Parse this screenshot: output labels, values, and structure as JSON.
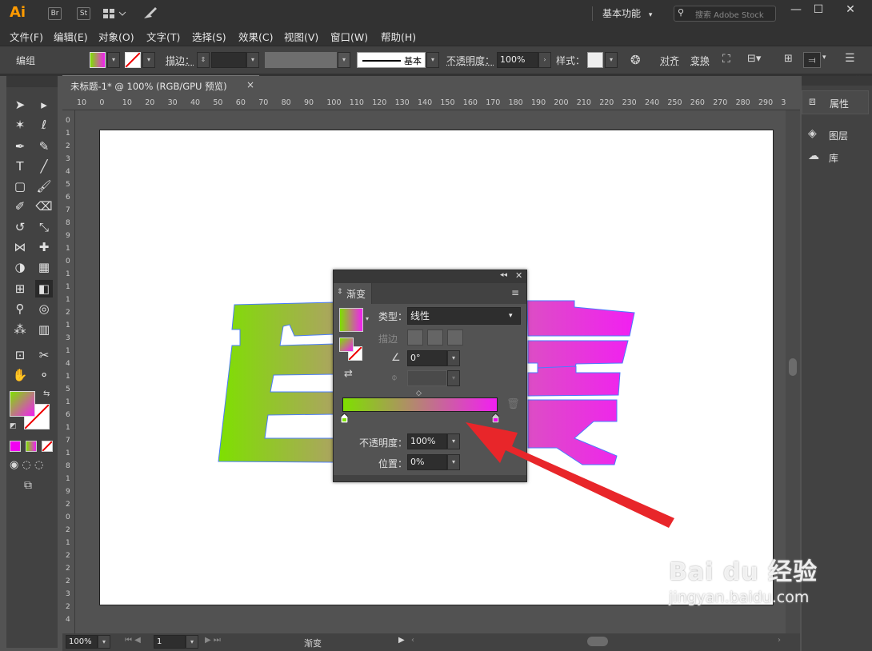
{
  "app": {
    "logo": "Ai",
    "br": "Br",
    "st": "St",
    "workspace": "基本功能",
    "search_placeholder": "搜索 Adobe Stock"
  },
  "menu": [
    "文件(F)",
    "编辑(E)",
    "对象(O)",
    "文字(T)",
    "选择(S)",
    "效果(C)",
    "视图(V)",
    "窗口(W)",
    "帮助(H)"
  ],
  "control": {
    "mode": "编组",
    "stroke_label": "描边：",
    "stroke_style": "基本",
    "opacity_label": "不透明度：",
    "opacity_value": "100%",
    "style_label": "样式：",
    "align_label": "对齐",
    "transform_label": "变换"
  },
  "document": {
    "tab_title": "未标题-1* @ 100% (RGB/GPU 预览)",
    "close": "×",
    "zoom": "100%",
    "artboard_index": "1",
    "status": "渐变"
  },
  "ruler": {
    "h": [
      "10",
      "0",
      "10",
      "20",
      "30",
      "40",
      "50",
      "60",
      "70",
      "80",
      "90",
      "100",
      "110",
      "120",
      "130",
      "140",
      "150",
      "160",
      "170",
      "180",
      "190",
      "200",
      "210",
      "220",
      "230",
      "240",
      "250",
      "260",
      "270",
      "280",
      "290",
      "3"
    ],
    "v": [
      "0",
      "1",
      "2",
      "3",
      "4",
      "5",
      "6",
      "7",
      "8",
      "9",
      "1",
      "0",
      "1",
      "1",
      "1",
      "2",
      "1",
      "3",
      "1",
      "4",
      "1",
      "5",
      "1",
      "6",
      "1",
      "7",
      "1",
      "8",
      "1",
      "9",
      "2",
      "0",
      "2",
      "1",
      "2",
      "2",
      "2",
      "3",
      "2",
      "4"
    ]
  },
  "right_panel": {
    "properties": "属性",
    "layers": "图层",
    "libraries": "库"
  },
  "gradient_panel": {
    "tab": "渐变",
    "type_label": "类型：",
    "type_value": "线性",
    "stroke_label": "描边",
    "angle_value": "0°",
    "opacity_label": "不透明度：",
    "opacity_value": "100%",
    "position_label": "位置：",
    "position_value": "0%",
    "stop_start_color": "#7fe400",
    "stop_end_color": "#f200f2"
  },
  "colors": {
    "gradient_start": "#7ee000",
    "gradient_end": "#f21ff2",
    "selection": "#4a7cff",
    "arrow": "#e8262a"
  },
  "watermark": {
    "brand": "Bai du 经验",
    "url": "jingyan.baidu.com"
  }
}
